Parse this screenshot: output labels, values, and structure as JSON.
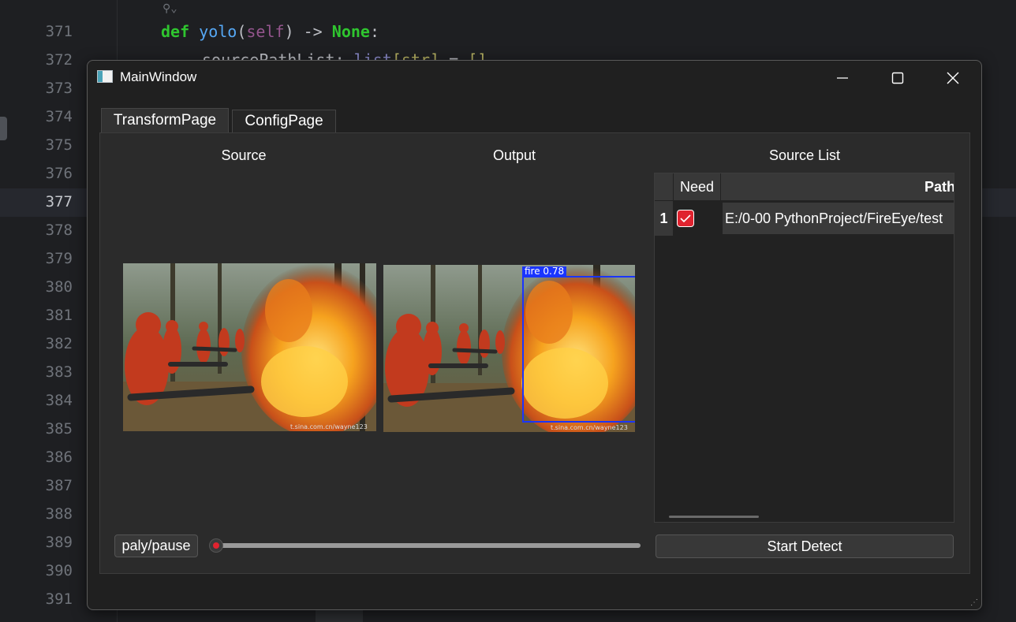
{
  "ide": {
    "line_numbers": [
      "371",
      "372",
      "373",
      "374",
      "375",
      "376",
      "377",
      "378",
      "379",
      "380",
      "381",
      "382",
      "383",
      "384",
      "385",
      "386",
      "387",
      "388",
      "389",
      "390",
      "391"
    ],
    "active_line": "377",
    "code_line_1": {
      "kw": "def",
      "fn": "yolo",
      "self": "self",
      "arrow": ") -> ",
      "none": "None",
      "colon": ":"
    },
    "code_line_2": {
      "var": "sourcePathList",
      "colon": ": ",
      "type": "list",
      "brk": "[str]",
      "assign": " = ",
      "val": "[]"
    }
  },
  "window": {
    "title": "MainWindow",
    "controls": {
      "minimize": "—",
      "maximize": "☐",
      "close": "✕"
    },
    "tabs": [
      "TransformPage",
      "ConfigPage"
    ],
    "active_tab": "TransformPage",
    "columns": {
      "source": "Source",
      "output": "Output",
      "source_list": "Source List"
    },
    "detection": {
      "label": "fire  0.78",
      "color": "#1a35ff"
    },
    "watermark": "t.sina.com.cn/wayne123",
    "table": {
      "headers": [
        "Need",
        "Path"
      ],
      "rows": [
        {
          "index": "1",
          "need": true,
          "path": "E:/0-00 PythonProject/FireEye/test"
        }
      ]
    },
    "play_button": "paly/pause",
    "slider_progress": 0.0,
    "detect_button": "Start Detect",
    "accent_color": "#e0232f"
  }
}
